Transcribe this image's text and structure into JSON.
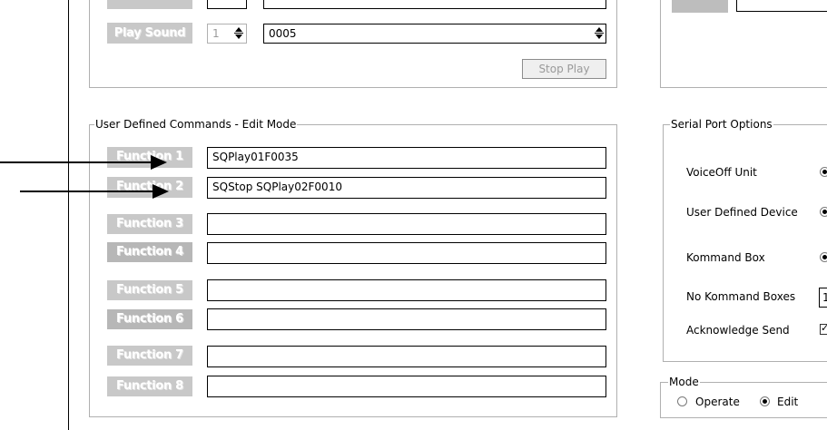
{
  "top_section": {
    "play_sound_button": "Play Sound",
    "play_sound_value": "1",
    "play_sound_text": "0005",
    "stop_play_button": "Stop Play"
  },
  "user_defined": {
    "legend": "User Defined Commands - Edit Mode",
    "functions": [
      {
        "label": "Function 1",
        "value": "SQPlay01F0035"
      },
      {
        "label": "Function 2",
        "value": "SQStop SQPlay02F0010"
      },
      {
        "label": "Function 3",
        "value": ""
      },
      {
        "label": "Function 4",
        "value": ""
      },
      {
        "label": "Function 5",
        "value": ""
      },
      {
        "label": "Function 6",
        "value": ""
      },
      {
        "label": "Function 7",
        "value": ""
      },
      {
        "label": "Function 8",
        "value": ""
      }
    ]
  },
  "serial_port": {
    "legend": "Serial Port Options",
    "voiceoff_unit": "VoiceOff Unit",
    "user_defined_device": "User Defined Device",
    "kommand_box": "Kommand Box",
    "no_kommand_boxes": "No Kommand Boxes",
    "no_kommand_boxes_value": "1",
    "acknowledge_send": "Acknowledge Send"
  },
  "mode": {
    "legend": "Mode",
    "operate": "Operate",
    "edit": "Edit",
    "selected": "Edit"
  },
  "colors": {
    "button_gray": "#c8c8c8",
    "frame_gray": "#b0b0b0"
  }
}
